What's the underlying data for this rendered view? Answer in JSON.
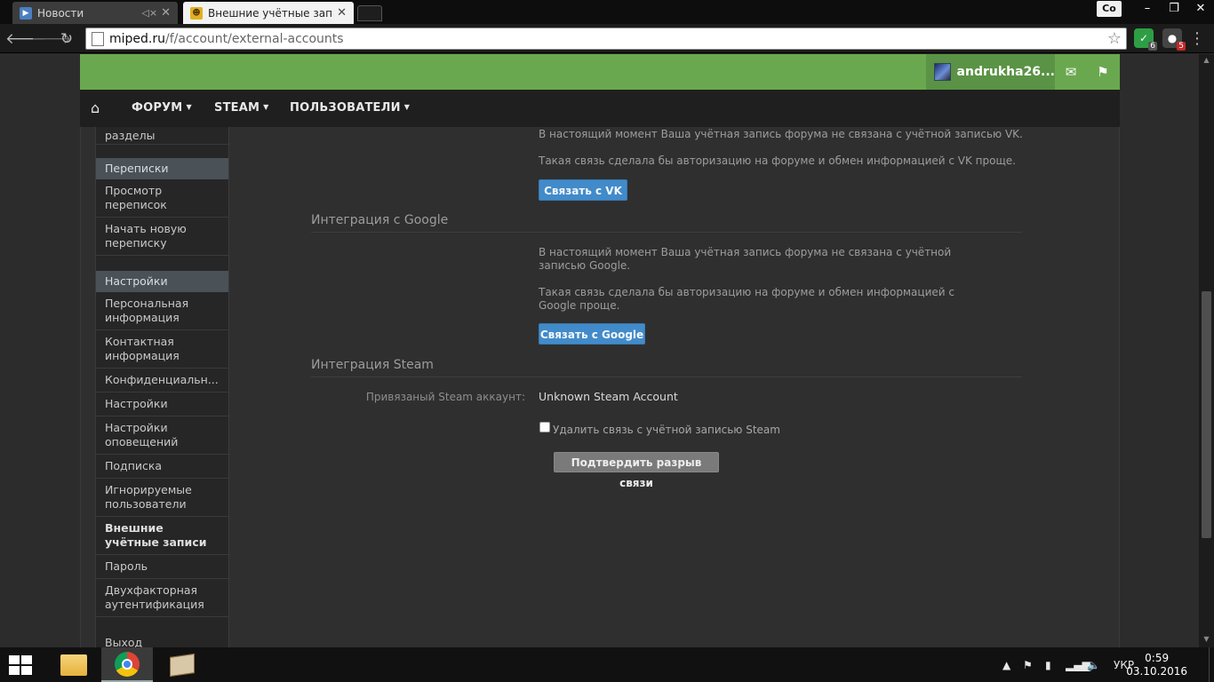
{
  "browser": {
    "tabs": [
      {
        "title": "Новости",
        "icon": "vk-news-icon"
      },
      {
        "title": "Внешние учётные записи",
        "icon": "miped-favicon"
      }
    ],
    "window_controls": {
      "minimize": "–",
      "restore": "❐",
      "close": "✕"
    },
    "profile_chip": "Co",
    "url_host": "miped.ru",
    "url_path": "/f/account/external-accounts",
    "extensions": [
      {
        "name": "adblock-shield-icon",
        "badge": "6",
        "color": "#2e9e44"
      },
      {
        "name": "ghostery-icon",
        "badge": "5",
        "color": "#555555"
      }
    ]
  },
  "header": {
    "username": "andrukha26...",
    "accent": "#6aa84f"
  },
  "nav": {
    "items": [
      {
        "label": "ФОРУМ"
      },
      {
        "label": "STEAM"
      },
      {
        "label": "ПОЛЬЗОВАТЕЛИ"
      }
    ]
  },
  "sidebar": {
    "top_item": "разделы",
    "sections": [
      {
        "heading": "Переписки",
        "items": [
          "Просмотр переписок",
          "Начать новую переписку"
        ]
      },
      {
        "heading": "Настройки",
        "items": [
          "Персональная информация",
          "Контактная информация",
          "Конфиденциальн...",
          "Настройки",
          "Настройки оповещений",
          "Подписка",
          "Игнорируемые пользователи",
          "Внешние учётные записи",
          "Пароль",
          "Двухфакторная аутентификация"
        ]
      }
    ],
    "logout": "Выход"
  },
  "main": {
    "vk": {
      "status": "В настоящий момент Ваша учётная запись форума не связана с учётной записью VK.",
      "benefit": "Такая связь сделала бы авторизацию на форуме и обмен информацией с VK проще.",
      "button": "Связать с VK"
    },
    "google": {
      "title": "Интеграция с Google",
      "status": "В настоящий момент Ваша учётная запись форума не связана с учётной записью Google.",
      "benefit": "Такая связь сделала бы авторизацию на форуме и обмен информацией с Google проще.",
      "button": "Связать с Google"
    },
    "steam": {
      "title": "Интеграция Steam",
      "linked_label": "Привязаный Steam аккаунт:",
      "linked_value": "Unknown Steam Account",
      "unlink_checkbox": "Удалить связь с учётной записью Steam",
      "confirm_button": "Подтвердить разрыв связи"
    }
  },
  "taskbar": {
    "language": "УКР",
    "time": "0:59",
    "date": "03.10.2016"
  }
}
